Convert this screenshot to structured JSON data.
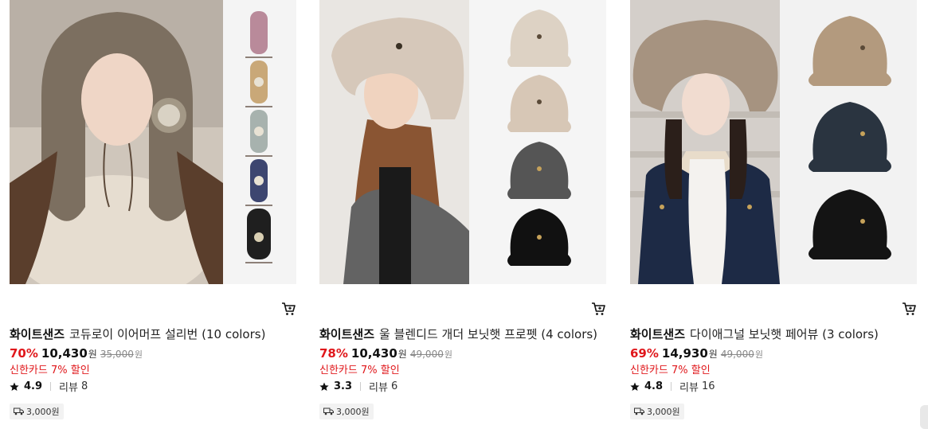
{
  "products": [
    {
      "brand": "화이트샌즈",
      "name": "코듀로이 이어머프 설리번 (10 colors)",
      "discount": "70%",
      "price": "10,430",
      "currency": "원",
      "original_price": "35,000",
      "original_currency": "원",
      "promo": "신한카드 7% 할인",
      "rating": "4.9",
      "review_label": "리뷰",
      "review_count": "8",
      "shipping": "3,000원",
      "cart_icon": "cart-icon",
      "colors": {
        "main_bg": "#cfc6bb",
        "thumb_bg": "#f4f4f4"
      }
    },
    {
      "brand": "화이트샌즈",
      "name": "울 블렌디드 개더 보닛햇 프로펫 (4 colors)",
      "discount": "78%",
      "price": "10,430",
      "currency": "원",
      "original_price": "49,000",
      "original_currency": "원",
      "promo": "신한카드 7% 할인",
      "rating": "3.3",
      "review_label": "리뷰",
      "review_count": "6",
      "shipping": "3,000원",
      "cart_icon": "cart-icon",
      "colors": {
        "main_bg": "#e9e6e2",
        "thumb_bg": "#f5f5f5"
      }
    },
    {
      "brand": "화이트샌즈",
      "name": "다이애그널 보닛햇 페어뷰 (3 colors)",
      "discount": "69%",
      "price": "14,930",
      "currency": "원",
      "original_price": "49,000",
      "original_currency": "원",
      "promo": "신한카드 7% 할인",
      "rating": "4.8",
      "review_label": "리뷰",
      "review_count": "16",
      "shipping": "3,000원",
      "cart_icon": "cart-icon",
      "colors": {
        "main_bg": "#d4cfca",
        "thumb_bg": "#f2f2f2"
      }
    }
  ],
  "theme": {
    "accent_red": "#e0171b"
  }
}
